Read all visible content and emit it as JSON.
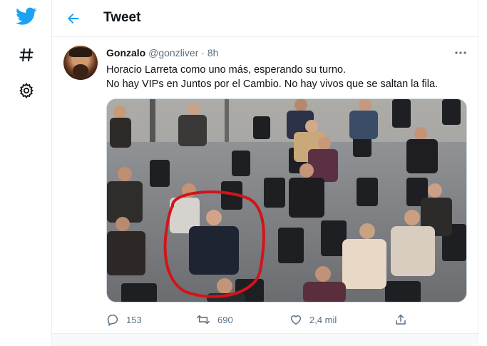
{
  "colors": {
    "accent": "#1da1f2",
    "secondary_text": "#5b7083",
    "annotation": "#d0151b"
  },
  "nav": {
    "icons": [
      "twitter-bird-icon",
      "hashtag-icon",
      "gear-icon"
    ]
  },
  "header": {
    "title": "Tweet",
    "back_icon": "arrow-left-icon"
  },
  "tweet": {
    "author": {
      "name": "Gonzalo",
      "handle": "@gonzliver",
      "separator": "·",
      "time": "8h"
    },
    "text": [
      "Horacio Larreta como uno más, esperando su turno.",
      "No hay VIPs en Juntos por el Cambio. No hay vivos que se saltan la fila."
    ],
    "media": {
      "description_icon": "photo-icon"
    },
    "actions": {
      "reply": {
        "icon": "reply-icon",
        "count": "153"
      },
      "retweet": {
        "icon": "retweet-icon",
        "count": "690"
      },
      "like": {
        "icon": "heart-icon",
        "count": "2,4 mil"
      },
      "share": {
        "icon": "share-icon"
      }
    }
  }
}
